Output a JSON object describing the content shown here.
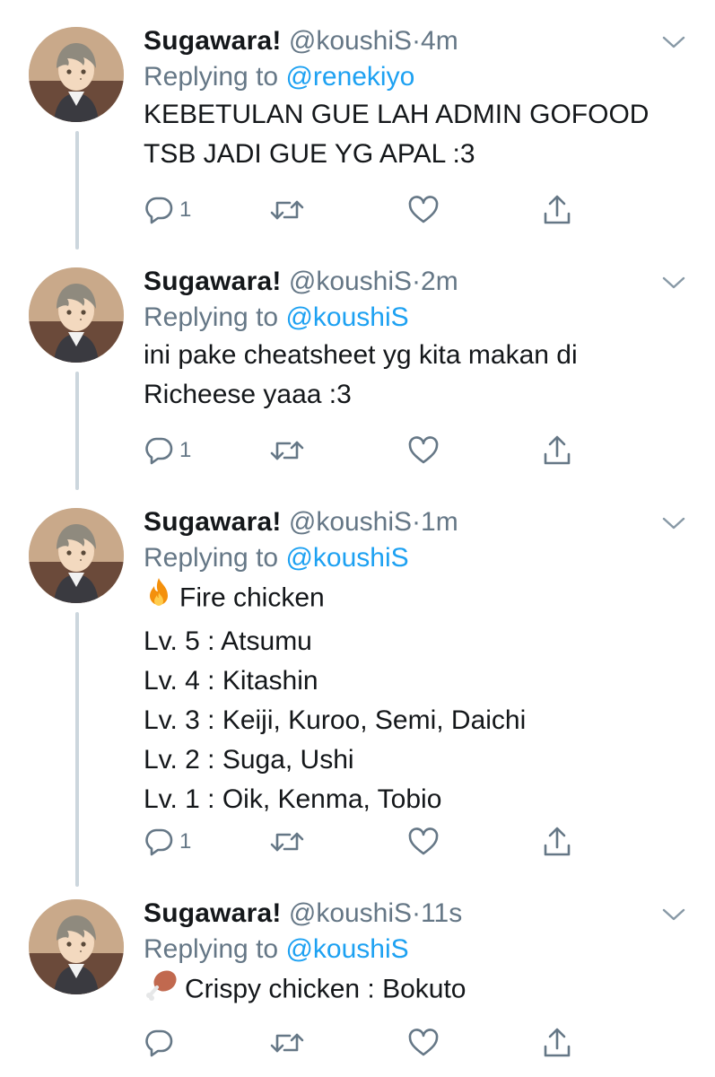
{
  "tweets": [
    {
      "name": "Sugawara!",
      "handle": "@koushiS",
      "dot": "·",
      "time": "4m",
      "replying_prefix": "Replying to",
      "replying_to": "@renekiyo",
      "lines": [
        "KEBETULAN GUE LAH ADMIN GOFOOD",
        "TSB JADI GUE YG APAL :3"
      ],
      "reply_count": "1"
    },
    {
      "name": "Sugawara!",
      "handle": "@koushiS",
      "dot": "·",
      "time": "2m",
      "replying_prefix": "Replying to",
      "replying_to": "@koushiS",
      "lines": [
        "ini pake cheatsheet yg kita makan di",
        "Richeese yaaa :3"
      ],
      "reply_count": "1"
    },
    {
      "name": "Sugawara!",
      "handle": "@koushiS",
      "dot": "·",
      "time": "1m",
      "replying_prefix": "Replying to",
      "replying_to": "@koushiS",
      "first_line_emoji": "fire-emoji",
      "lines": [
        "Fire chicken",
        "Lv. 5 : Atsumu",
        "Lv. 4 : Kitashin",
        "Lv. 3 : Keiji, Kuroo, Semi, Daichi",
        "Lv. 2 : Suga, Ushi",
        "Lv. 1 : Oik, Kenma, Tobio"
      ],
      "reply_count": "1"
    },
    {
      "name": "Sugawara!",
      "handle": "@koushiS",
      "dot": "·",
      "time": "11s",
      "replying_prefix": "Replying to",
      "replying_to": "@koushiS",
      "first_line_emoji": "drumstick-emoji",
      "lines": [
        "Crispy chicken : Bokuto"
      ],
      "reply_count": ""
    }
  ],
  "colors": {
    "text": "#14171a",
    "secondary": "#657786",
    "link": "#1da1f2",
    "thread_line": "#ccd6dd"
  },
  "icons": [
    "reply-icon",
    "retweet-icon",
    "like-icon",
    "share-icon",
    "chevron-down-icon",
    "fire-emoji",
    "drumstick-emoji"
  ]
}
